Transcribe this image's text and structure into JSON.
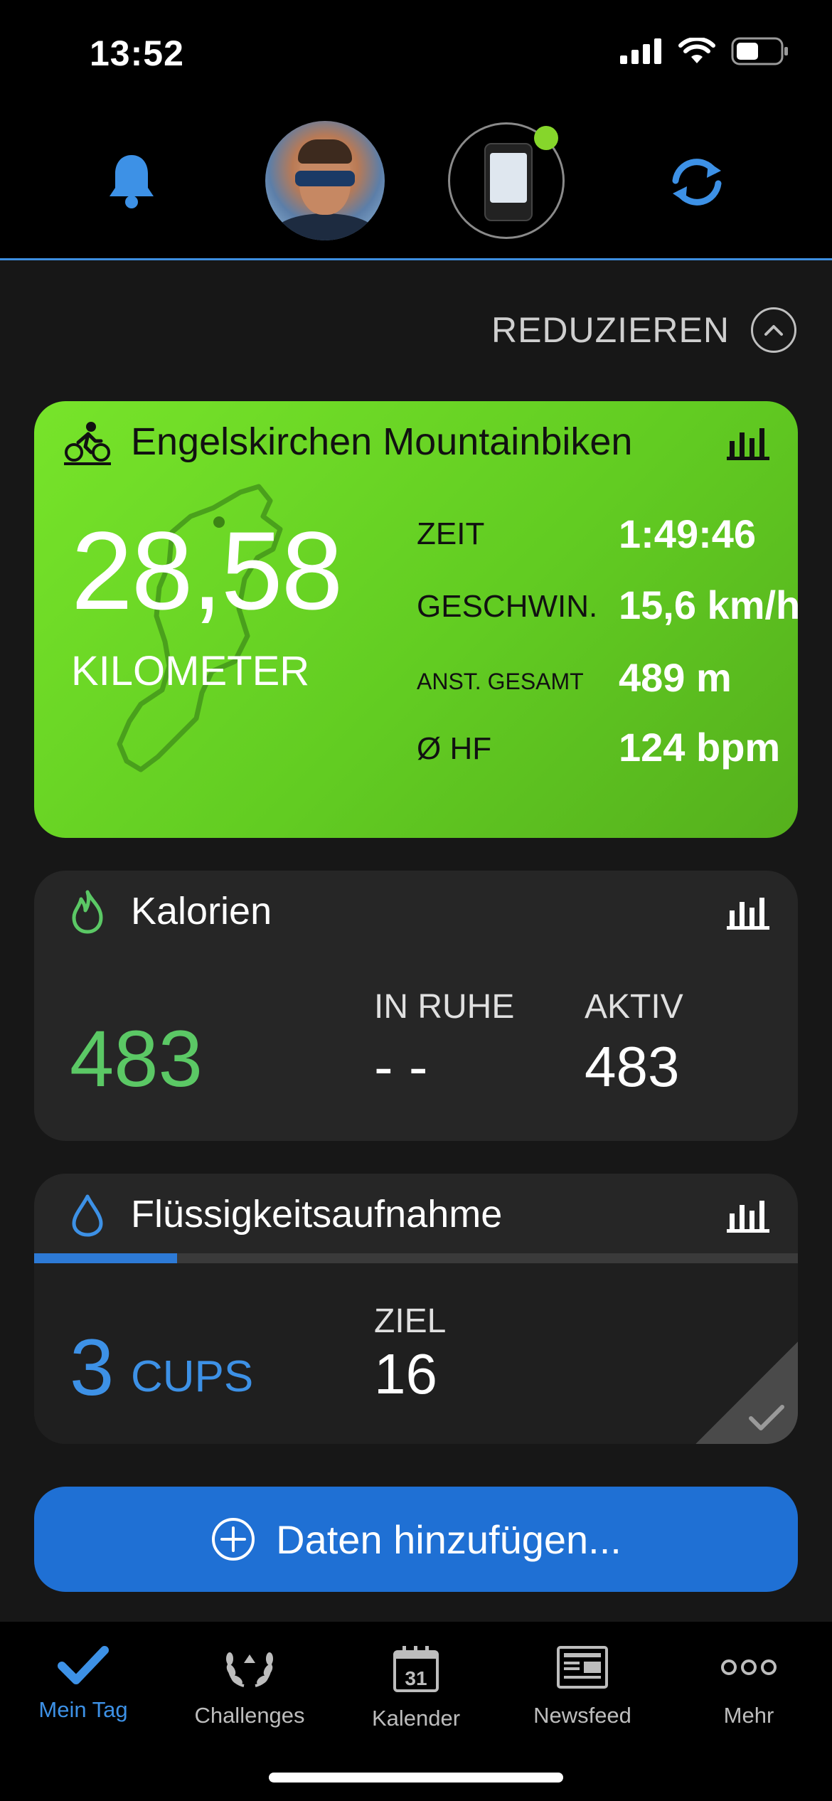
{
  "status_bar": {
    "time": "13:52"
  },
  "header": {
    "icons": [
      "bell-icon",
      "profile-avatar",
      "device-status",
      "sync-icon"
    ],
    "device_connected_color": "#86d62b"
  },
  "reduce": {
    "label": "REDUZIEREN"
  },
  "activity": {
    "title": "Engelskirchen Mountainbiken",
    "distance": "28,58",
    "distance_unit": "KILOMETER",
    "stats": [
      {
        "label": "ZEIT",
        "value": "1:49:46"
      },
      {
        "label": "GESCHWIN.",
        "value": "15,6 km/h"
      },
      {
        "label": "ANST. GESAMT",
        "value": "489 m"
      },
      {
        "label": "Ø HF",
        "value": "124 bpm"
      }
    ],
    "color": "#6cd626"
  },
  "calories": {
    "title": "Kalorien",
    "total": "483",
    "resting_label": "IN RUHE",
    "resting_value": "- -",
    "active_label": "AKTIV",
    "active_value": "483",
    "color": "#5bc865"
  },
  "hydration": {
    "title": "Flüssigkeitsaufnahme",
    "value": "3",
    "unit": "CUPS",
    "goal_label": "ZIEL",
    "goal_value": "16",
    "progress_fraction": 0.1875,
    "color": "#3d91e6"
  },
  "add_button": {
    "label": "Daten hinzufügen..."
  },
  "tabs": [
    {
      "label": "Mein Tag",
      "icon": "checkmark-icon",
      "active": true
    },
    {
      "label": "Challenges",
      "icon": "laurel-icon",
      "active": false
    },
    {
      "label": "Kalender",
      "icon": "calendar-icon",
      "badge": "31",
      "active": false
    },
    {
      "label": "Newsfeed",
      "icon": "newspaper-icon",
      "active": false
    },
    {
      "label": "Mehr",
      "icon": "more-icon",
      "active": false
    }
  ]
}
